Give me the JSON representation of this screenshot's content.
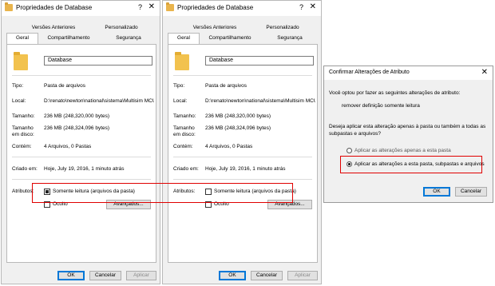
{
  "window1": {
    "title": "Propriedades de Database",
    "help": "?",
    "close": "✕",
    "tabs_top": [
      "Versões Anteriores",
      "Personalizado"
    ],
    "tabs_bottom": [
      "Geral",
      "Compartilhamento",
      "Segurança"
    ],
    "name": "Database",
    "rows": [
      {
        "label": "Tipo:",
        "value": "Pasta de arquivos"
      },
      {
        "label": "Local:",
        "value": "D:\\renato\\newton\\national\\sistema\\Multisim MCU C"
      },
      {
        "label": "Tamanho:",
        "value": "236 MB (248,320,000 bytes)"
      },
      {
        "label": "Tamanho em disco:",
        "value": "236 MB (248,324,096 bytes)"
      },
      {
        "label": "Contém:",
        "value": "4 Arquivos, 0 Pastas"
      },
      {
        "label": "Criado em:",
        "value": "Hoje, July 19, 2016, 1 minuto atrás"
      }
    ],
    "attributes_label": "Atributos:",
    "readonly_label": "Somente leitura (arquivos da pasta)",
    "hidden_label": "Oculto",
    "advanced_label": "Avançados...",
    "ok": "OK",
    "cancel": "Cancelar",
    "apply": "Aplicar"
  },
  "window2": {
    "title": "Propriedades de Database",
    "help": "?",
    "close": "✕",
    "tabs_top": [
      "Versões Anteriores",
      "Personalizado"
    ],
    "tabs_bottom": [
      "Geral",
      "Compartilhamento",
      "Segurança"
    ],
    "name": "Database",
    "rows": [
      {
        "label": "Tipo:",
        "value": "Pasta de arquivos"
      },
      {
        "label": "Local:",
        "value": "D:\\renato\\newton\\national\\sistema\\Multisim MCU C"
      },
      {
        "label": "Tamanho:",
        "value": "236 MB (248,320,000 bytes)"
      },
      {
        "label": "Tamanho em disco:",
        "value": "236 MB (248,324,096 bytes)"
      },
      {
        "label": "Contém:",
        "value": "4 Arquivos, 0 Pastas"
      },
      {
        "label": "Criado em:",
        "value": "Hoje, July 19, 2016, 1 minuto atrás"
      }
    ],
    "attributes_label": "Atributos:",
    "readonly_label": "Somente leitura (arquivos da pasta)",
    "hidden_label": "Oculto",
    "advanced_label": "Avançados...",
    "ok": "OK",
    "cancel": "Cancelar",
    "apply": "Aplicar"
  },
  "dialog": {
    "title": "Confirmar Alterações de Atributo",
    "close": "✕",
    "intro": "Você optou por fazer as seguintes alterações de atributo:",
    "change": "remover definição somente leitura",
    "question_line1": "Deseja aplicar esta alteração apenas à pasta ou também a todas as",
    "question_line2": "subpastas e arquivos?",
    "option1": "Aplicar as alterações apenas a esta pasta",
    "option2": "Aplicar as alterações a esta pasta, subpastas e arquivos",
    "ok": "OK",
    "cancel": "Cancelar"
  },
  "colors": {
    "highlight": "#e00000",
    "accent": "#0078d7",
    "folder": "#f2c24e"
  }
}
